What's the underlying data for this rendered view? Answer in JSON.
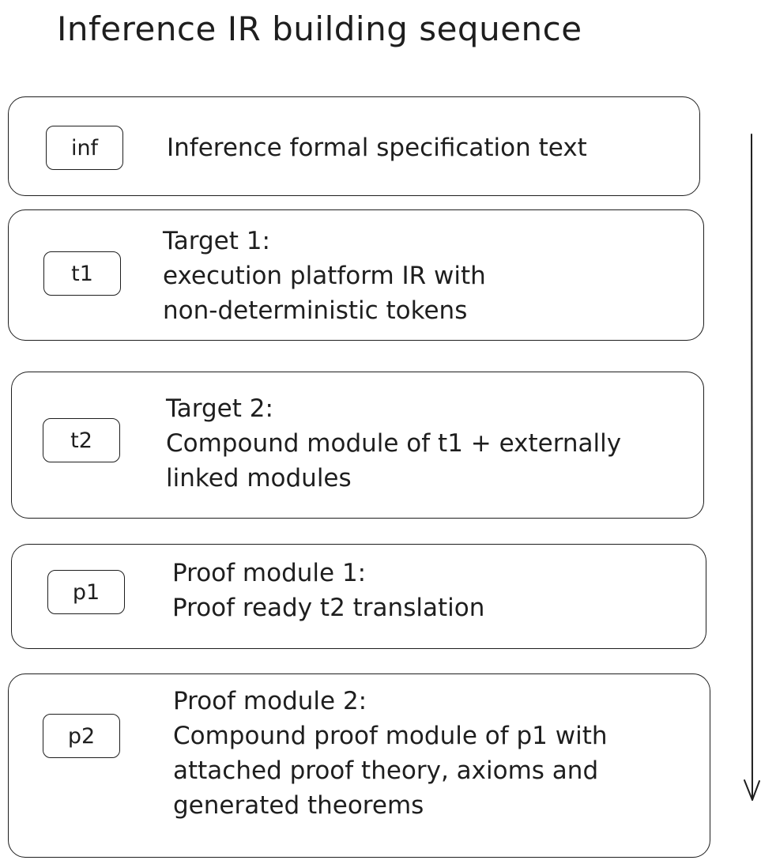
{
  "title": "Inference IR building sequence",
  "stages": [
    {
      "tag": "inf",
      "lines": [
        "Inference formal specification text"
      ]
    },
    {
      "tag": "t1",
      "lines": [
        "Target 1:",
        "execution platform IR with",
        "non-deterministic tokens"
      ]
    },
    {
      "tag": "t2",
      "lines": [
        "Target 2:",
        "Compound module of t1 + externally",
        "linked modules"
      ]
    },
    {
      "tag": "p1",
      "lines": [
        "Proof module 1:",
        "Proof ready t2 translation"
      ]
    },
    {
      "tag": "p2",
      "lines": [
        "Proof module 2:",
        "Compound proof module of p1 with",
        "attached proof theory, axioms and",
        "generated theorems"
      ]
    }
  ],
  "flow_arrow": {
    "direction": "down"
  }
}
